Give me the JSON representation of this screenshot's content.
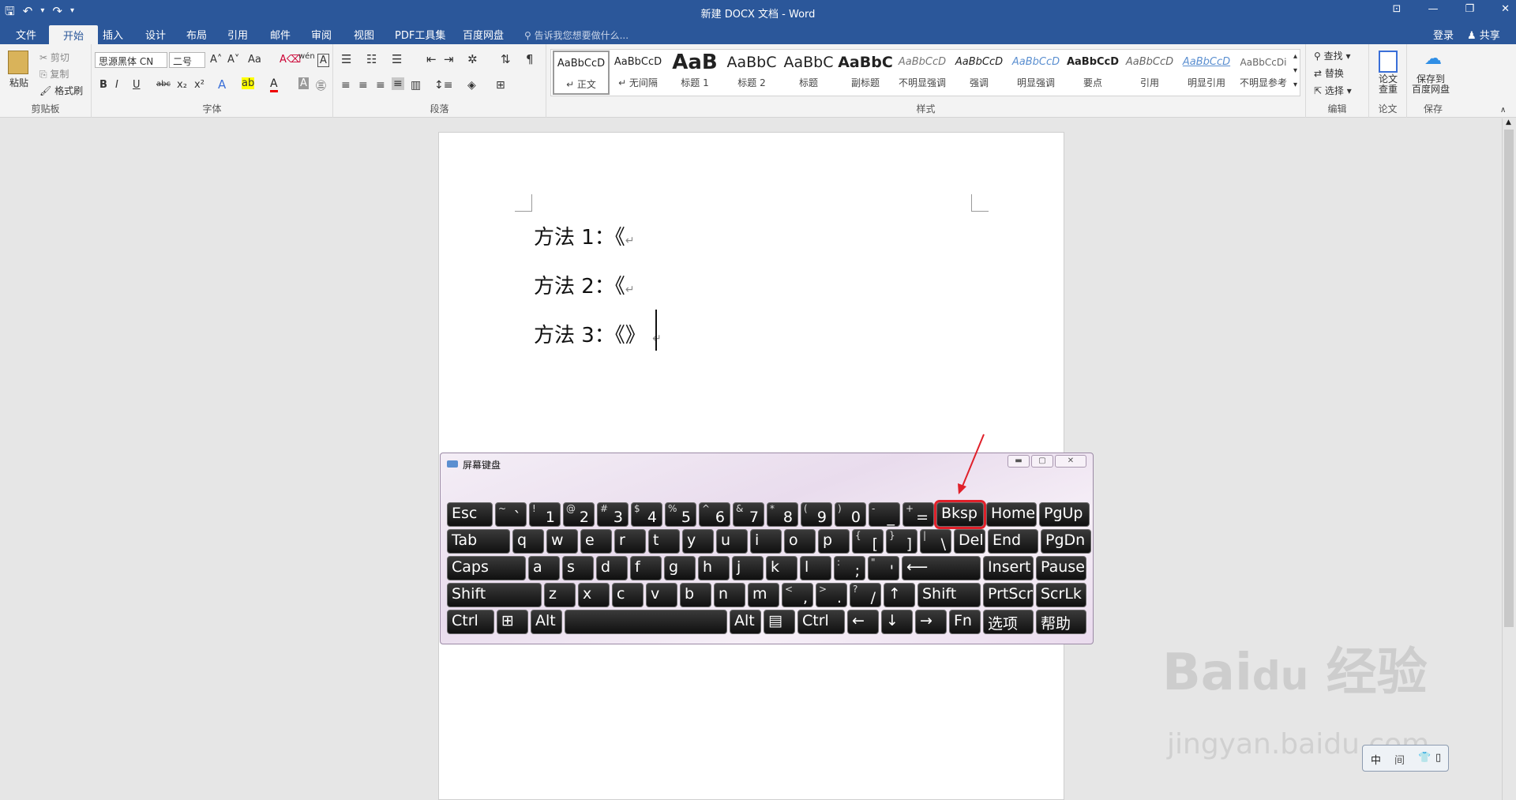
{
  "window": {
    "title": "新建 DOCX 文档 - Word"
  },
  "qat": {
    "save": "🖫",
    "undo": "↶",
    "undo_dd": "▾",
    "redo": "↷",
    "customize": "▾"
  },
  "win_controls": {
    "options": "⊡",
    "minimize": "—",
    "restore": "❐",
    "close": "✕"
  },
  "tabs": [
    "文件",
    "开始",
    "插入",
    "设计",
    "布局",
    "引用",
    "邮件",
    "审阅",
    "视图",
    "PDF工具集",
    "百度网盘"
  ],
  "tellme": "告诉我您想要做什么...",
  "account": {
    "login": "登录",
    "share": "共享"
  },
  "clipboard": {
    "paste": "粘贴",
    "cut": "剪切",
    "copy": "复制",
    "format_painter": "格式刷",
    "label": "剪贴板"
  },
  "font": {
    "name": "思源黑体 CN",
    "size": "二号",
    "label": "字体",
    "bold": "B",
    "italic": "I",
    "underline": "U",
    "strike": "abc",
    "sub": "x₂",
    "sup": "x²",
    "grow": "A˄",
    "shrink": "A˅",
    "case": "Aa",
    "clear": "A⌫",
    "wen": "wén",
    "border_a": "A"
  },
  "paragraph": {
    "label": "段落"
  },
  "styles": {
    "label": "样式",
    "items": [
      {
        "preview": "AaBbCcD",
        "name": "↵ 正文"
      },
      {
        "preview": "AaBbCcD",
        "name": "↵ 无间隔"
      },
      {
        "preview": "AaB",
        "name": "标题 1"
      },
      {
        "preview": "AaBbC",
        "name": "标题 2"
      },
      {
        "preview": "AaBbC",
        "name": "标题"
      },
      {
        "preview": "AaBbC",
        "name": "副标题"
      },
      {
        "preview": "AaBbCcD",
        "name": "不明显强调"
      },
      {
        "preview": "AaBbCcD",
        "name": "强调"
      },
      {
        "preview": "AaBbCcD",
        "name": "明显强调"
      },
      {
        "preview": "AaBbCcD",
        "name": "要点"
      },
      {
        "preview": "AaBbCcD",
        "name": "引用"
      },
      {
        "preview": "AaBbCcD",
        "name": "明显引用"
      },
      {
        "preview": "AaBbCcDi",
        "name": "不明显参考"
      }
    ]
  },
  "editing": {
    "find": "查找",
    "replace": "替换",
    "select": "选择",
    "label": "编辑"
  },
  "paper": {
    "check": "论文\n查重",
    "label": "论文"
  },
  "save_group": {
    "save_baidu": "保存到\n百度网盘",
    "label": "保存"
  },
  "document": {
    "lines": [
      "方法 1：《",
      "方法 2：《",
      "方法 3：《》"
    ],
    "para_mark": "↵"
  },
  "osk": {
    "title": "屏幕键盘",
    "rows": [
      [
        {
          "m": "Esc",
          "w": 58
        },
        {
          "sh": "~",
          "lo": "`",
          "w": 40
        },
        {
          "sh": "!",
          "lo": "1",
          "w": 40
        },
        {
          "sh": "@",
          "lo": "2",
          "w": 40
        },
        {
          "sh": "#",
          "lo": "3",
          "w": 40
        },
        {
          "sh": "$",
          "lo": "4",
          "w": 40
        },
        {
          "sh": "%",
          "lo": "5",
          "w": 40
        },
        {
          "sh": "^",
          "lo": "6",
          "w": 40
        },
        {
          "sh": "&",
          "lo": "7",
          "w": 40
        },
        {
          "sh": "*",
          "lo": "8",
          "w": 40
        },
        {
          "sh": "(",
          "lo": "9",
          "w": 40
        },
        {
          "sh": ")",
          "lo": "0",
          "w": 40
        },
        {
          "sh": "-",
          "lo": "_",
          "w": 40
        },
        {
          "sh": "+",
          "lo": "=",
          "w": 40
        },
        {
          "m": "Bksp",
          "w": 60,
          "hl": true
        },
        {
          "m": "Home",
          "w": 64
        },
        {
          "m": "PgUp",
          "w": 64
        }
      ],
      [
        {
          "m": "Tab",
          "w": 80
        },
        {
          "m": "q",
          "w": 40
        },
        {
          "m": "w",
          "w": 40
        },
        {
          "m": "e",
          "w": 40
        },
        {
          "m": "r",
          "w": 40
        },
        {
          "m": "t",
          "w": 40
        },
        {
          "m": "y",
          "w": 40
        },
        {
          "m": "u",
          "w": 40
        },
        {
          "m": "i",
          "w": 40
        },
        {
          "m": "o",
          "w": 40
        },
        {
          "m": "p",
          "w": 40
        },
        {
          "sh": "{",
          "lo": "[",
          "w": 40
        },
        {
          "sh": "}",
          "lo": "]",
          "w": 40
        },
        {
          "sh": "|",
          "lo": "\\",
          "w": 40
        },
        {
          "m": "Del",
          "w": 40
        },
        {
          "m": "End",
          "w": 64
        },
        {
          "m": "PgDn",
          "w": 64
        }
      ],
      [
        {
          "m": "Caps",
          "w": 100
        },
        {
          "m": "a",
          "w": 40
        },
        {
          "m": "s",
          "w": 40
        },
        {
          "m": "d",
          "w": 40
        },
        {
          "m": "f",
          "w": 40
        },
        {
          "m": "g",
          "w": 40
        },
        {
          "m": "h",
          "w": 40
        },
        {
          "m": "j",
          "w": 40
        },
        {
          "m": "k",
          "w": 40
        },
        {
          "m": "l",
          "w": 40
        },
        {
          "sh": ":",
          "lo": ";",
          "w": 40
        },
        {
          "sh": "\"",
          "lo": "'",
          "w": 40
        },
        {
          "m": "⟵",
          "w": 100
        },
        {
          "m": "Insert",
          "w": 64
        },
        {
          "m": "Pause",
          "w": 64
        }
      ],
      [
        {
          "m": "Shift",
          "w": 120
        },
        {
          "m": "z",
          "w": 40
        },
        {
          "m": "x",
          "w": 40
        },
        {
          "m": "c",
          "w": 40
        },
        {
          "m": "v",
          "w": 40
        },
        {
          "m": "b",
          "w": 40
        },
        {
          "m": "n",
          "w": 40
        },
        {
          "m": "m",
          "w": 40
        },
        {
          "sh": "<",
          "lo": ",",
          "w": 40
        },
        {
          "sh": ">",
          "lo": ".",
          "w": 40
        },
        {
          "sh": "?",
          "lo": "/",
          "w": 40
        },
        {
          "m": "↑",
          "w": 40
        },
        {
          "m": "Shift",
          "w": 80
        },
        {
          "m": "PrtScn",
          "w": 64
        },
        {
          "m": "ScrLk",
          "w": 64
        }
      ],
      [
        {
          "m": "Ctrl",
          "w": 60
        },
        {
          "m": "⊞",
          "w": 40
        },
        {
          "m": "Alt",
          "w": 40
        },
        {
          "m": "",
          "w": 206
        },
        {
          "m": "Alt",
          "w": 40
        },
        {
          "m": "▤",
          "w": 40
        },
        {
          "m": "Ctrl",
          "w": 60
        },
        {
          "m": "←",
          "w": 40
        },
        {
          "m": "↓",
          "w": 40
        },
        {
          "m": "→",
          "w": 40
        },
        {
          "m": "Fn",
          "w": 40
        },
        {
          "m": "选项",
          "w": 64
        },
        {
          "m": "帮助",
          "w": 64
        }
      ]
    ]
  },
  "ime": {
    "mode": "中",
    "sep": "间",
    "shirt": "👕",
    "opt": "▯"
  }
}
